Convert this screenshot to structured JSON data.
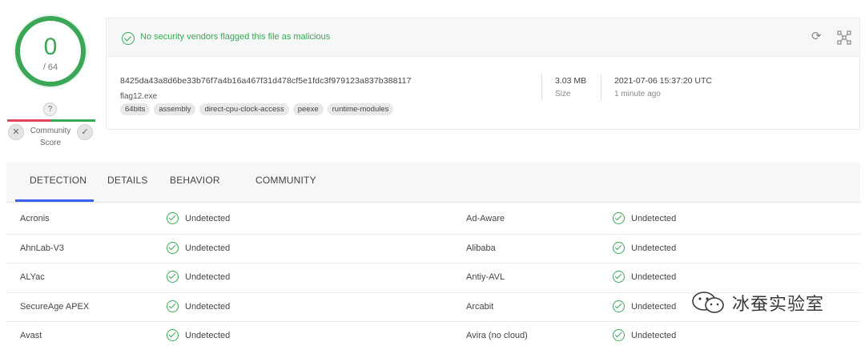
{
  "score": {
    "detected": "0",
    "total": "/ 64",
    "unknown_badge": "?"
  },
  "community": {
    "label": "Community\nScore",
    "label_line1": "Community",
    "label_line2": "Score",
    "dislike": "✕",
    "like": "✓"
  },
  "summary": {
    "message": "No security vendors flagged this file as malicious",
    "hash": "8425da43a8d6be33b76f7a4b16a467f31d478cf5e1fdc3f979123a837b388117",
    "filename": "flag12.exe",
    "tags": [
      "64bits",
      "assembly",
      "direct-cpu-clock-access",
      "peexe",
      "runtime-modules"
    ],
    "size_value": "3.03 MB",
    "size_label": "Size",
    "date_value": "2021-07-06 15:37:20 UTC",
    "date_label": "1 minute ago",
    "icons": [
      "reanalyze-icon",
      "graph-icon"
    ]
  },
  "tabs": [
    "DETECTION",
    "DETAILS",
    "BEHAVIOR",
    "COMMUNITY"
  ],
  "active_tab": "DETECTION",
  "detections": [
    {
      "left_vendor": "Acronis",
      "left_result": "Undetected",
      "right_vendor": "Ad-Aware",
      "right_result": "Undetected"
    },
    {
      "left_vendor": "AhnLab-V3",
      "left_result": "Undetected",
      "right_vendor": "Alibaba",
      "right_result": "Undetected"
    },
    {
      "left_vendor": "ALYac",
      "left_result": "Undetected",
      "right_vendor": "Antiy-AVL",
      "right_result": "Undetected"
    },
    {
      "left_vendor": "SecureAge APEX",
      "left_result": "Undetected",
      "right_vendor": "Arcabit",
      "right_result": "Undetected"
    },
    {
      "left_vendor": "Avast",
      "left_result": "Undetected",
      "right_vendor": "Avira (no cloud)",
      "right_result": "Undetected"
    }
  ],
  "watermark": {
    "text": "冰蚕实验室",
    "icon": "wechat-icon"
  },
  "colors": {
    "ok_green": "#3aa757",
    "malicious_red": "#e3455e",
    "tab_accent": "#3b61ee"
  }
}
